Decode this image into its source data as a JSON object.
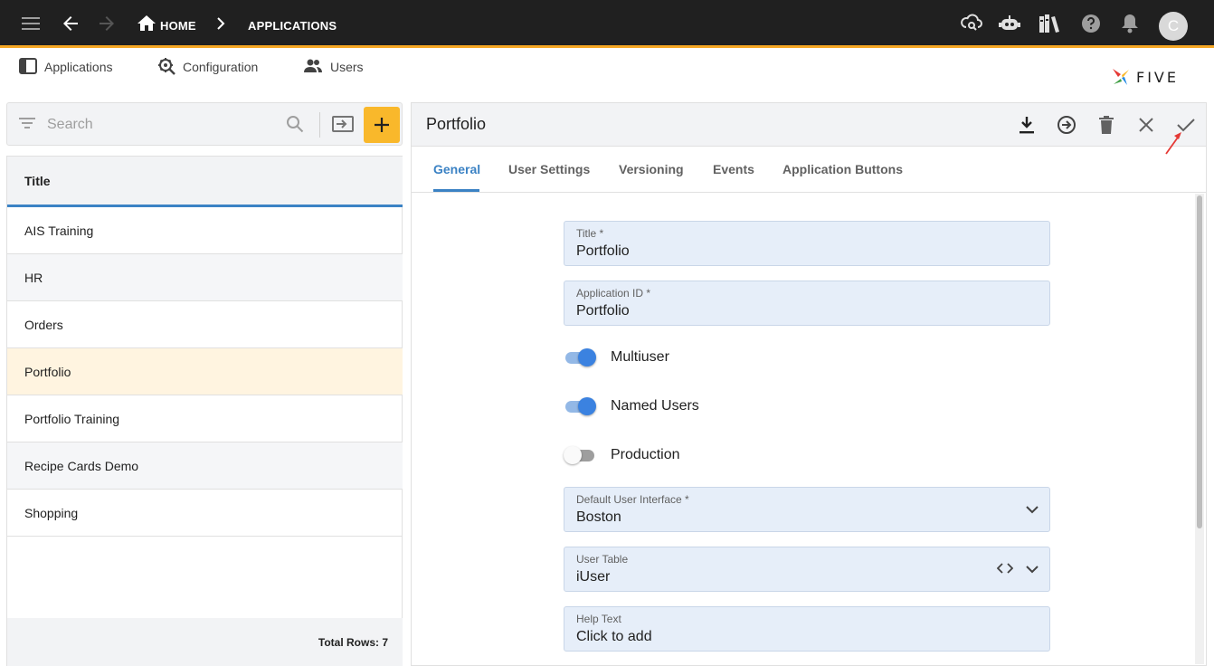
{
  "topbar": {
    "breadcrumbs": [
      {
        "label": "HOME",
        "icon": "home-icon"
      },
      {
        "label": "APPLICATIONS"
      }
    ],
    "icons": [
      "menu-icon",
      "back-arrow-icon",
      "forward-arrow-icon",
      "cloud-search-icon",
      "robot-icon",
      "library-icon",
      "help-icon",
      "bell-icon"
    ],
    "avatar_initial": "C",
    "accent_color": "#f5a623"
  },
  "subnav": {
    "items": [
      {
        "label": "Applications",
        "icon": "applications-icon"
      },
      {
        "label": "Configuration",
        "icon": "gear-wrench-icon"
      },
      {
        "label": "Users",
        "icon": "users-icon"
      }
    ],
    "logo_text": "FIVE"
  },
  "list": {
    "search_placeholder": "Search",
    "column_header": "Title",
    "rows": [
      "AIS Training",
      "HR",
      "Orders",
      "Portfolio",
      "Portfolio Training",
      "Recipe Cards Demo",
      "Shopping"
    ],
    "selected_row": "Portfolio",
    "footer": "Total Rows: 7"
  },
  "detail": {
    "title": "Portfolio",
    "actions": [
      "download-icon",
      "arrow-circle-right-icon",
      "trash-icon",
      "close-icon",
      "check-icon"
    ],
    "tabs": [
      "General",
      "User Settings",
      "Versioning",
      "Events",
      "Application Buttons"
    ],
    "active_tab": "General",
    "fields": {
      "title": {
        "label": "Title *",
        "value": "Portfolio"
      },
      "application_id": {
        "label": "Application ID *",
        "value": "Portfolio"
      },
      "default_ui": {
        "label": "Default User Interface *",
        "value": "Boston"
      },
      "user_table": {
        "label": "User Table",
        "value": "iUser"
      },
      "help_text": {
        "label": "Help Text",
        "value": "Click to add"
      }
    },
    "toggles": [
      {
        "label": "Multiuser",
        "on": true
      },
      {
        "label": "Named Users",
        "on": true
      },
      {
        "label": "Production",
        "on": false
      }
    ],
    "accent_color": "#3b82c4"
  }
}
